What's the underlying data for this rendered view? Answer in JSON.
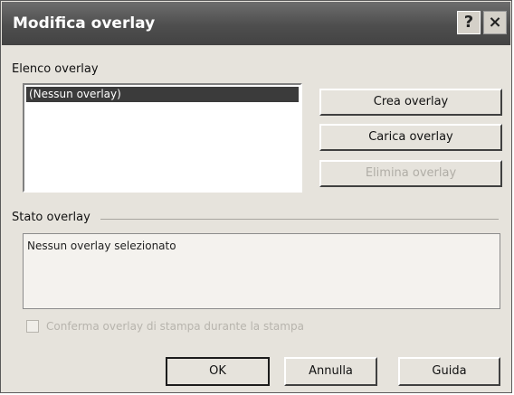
{
  "window": {
    "title": "Modifica overlay",
    "help_glyph": "?",
    "close_glyph": "×"
  },
  "overlay_list": {
    "label": "Elenco overlay",
    "selected_item": "(Nessun overlay)"
  },
  "buttons": {
    "create": "Crea overlay",
    "load": "Carica overlay",
    "delete": "Elimina overlay",
    "ok": "OK",
    "cancel": "Annulla",
    "help": "Guida"
  },
  "status": {
    "label": "Stato overlay",
    "text": "Nessun overlay selezionato"
  },
  "option": {
    "checkbox_label": "Conferma overlay di stampa durante la stampa",
    "checked": false
  }
}
